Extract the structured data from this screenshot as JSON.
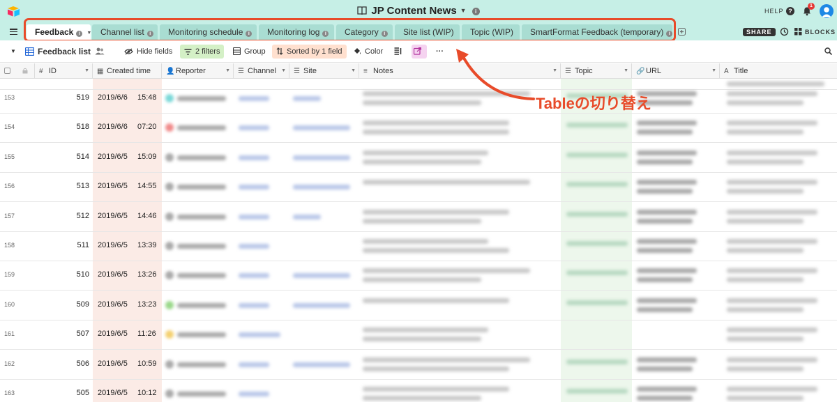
{
  "header": {
    "base_name": "JP Content News",
    "help_label": "HELP",
    "help_icon": "?",
    "info_icon": "i",
    "notification_count": "1"
  },
  "tabs": [
    {
      "label": "Feedback",
      "active": true
    },
    {
      "label": "Channel list",
      "active": false
    },
    {
      "label": "Monitoring schedule",
      "active": false
    },
    {
      "label": "Monitoring log",
      "active": false
    },
    {
      "label": "Category",
      "active": false
    },
    {
      "label": "Site list (WIP)",
      "active": false
    },
    {
      "label": "Topic (WIP)",
      "active": false
    },
    {
      "label": "SmartFormat Feedback (temporary)",
      "active": false
    }
  ],
  "right_controls": {
    "share_label": "SHARE",
    "blocks_label": "BLOCKS"
  },
  "toolbar": {
    "view_name": "Feedback list",
    "hide_fields": "Hide fields",
    "filters": "2 filters",
    "group": "Group",
    "sorted": "Sorted by 1 field",
    "color": "Color",
    "more": "···"
  },
  "columns": {
    "id": "ID",
    "created": "Created time",
    "reporter": "Reporter",
    "channel": "Channel",
    "site": "Site",
    "notes": "Notes",
    "topic": "Topic",
    "url": "URL",
    "title": "Title"
  },
  "rows": [
    {
      "num": "153",
      "id": "519",
      "date": "2019/6/6",
      "time": "15:48"
    },
    {
      "num": "154",
      "id": "518",
      "date": "2019/6/6",
      "time": "07:20"
    },
    {
      "num": "155",
      "id": "514",
      "date": "2019/6/5",
      "time": "15:09"
    },
    {
      "num": "156",
      "id": "513",
      "date": "2019/6/5",
      "time": "14:55"
    },
    {
      "num": "157",
      "id": "512",
      "date": "2019/6/5",
      "time": "14:46"
    },
    {
      "num": "158",
      "id": "511",
      "date": "2019/6/5",
      "time": "13:39"
    },
    {
      "num": "159",
      "id": "510",
      "date": "2019/6/5",
      "time": "13:26"
    },
    {
      "num": "160",
      "id": "509",
      "date": "2019/6/5",
      "time": "13:23"
    },
    {
      "num": "161",
      "id": "507",
      "date": "2019/6/5",
      "time": "11:26"
    },
    {
      "num": "162",
      "id": "506",
      "date": "2019/6/5",
      "time": "10:59"
    },
    {
      "num": "163",
      "id": "505",
      "date": "2019/6/5",
      "time": "10:12"
    }
  ],
  "annotation": {
    "text": "Tableの切り替え",
    "color": "#e84b2a"
  },
  "colors": {
    "header_bg": "#c6efe6",
    "tab_bg": "#a9ddd2",
    "accent": "#e84b2a"
  }
}
